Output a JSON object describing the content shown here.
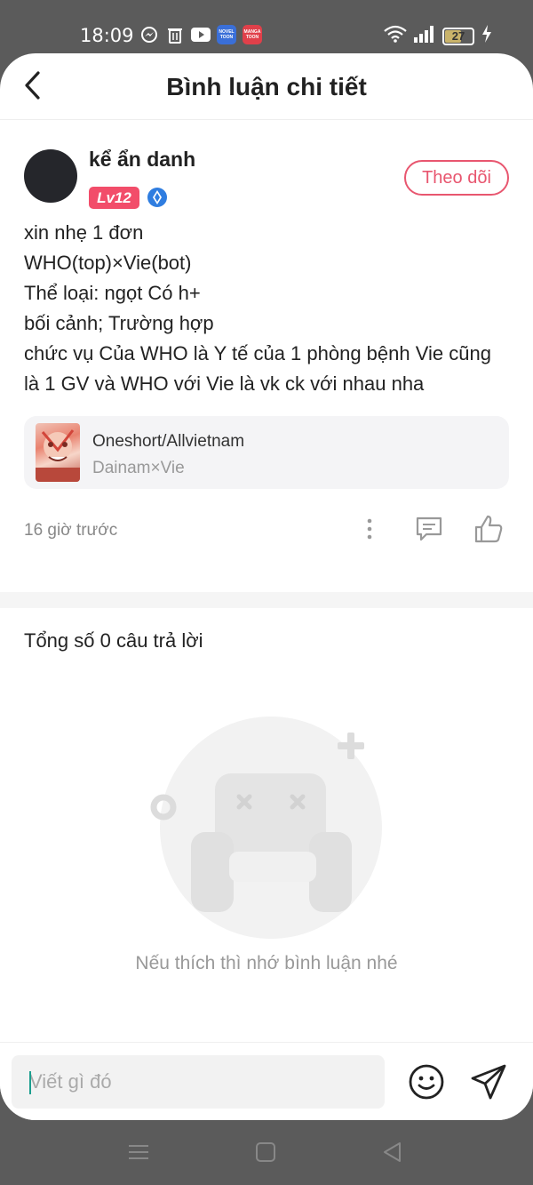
{
  "status_bar": {
    "time": "18:09",
    "battery": "27",
    "app_icons": [
      "messenger-icon",
      "trash-icon",
      "youtube-icon",
      "novel-toon-icon",
      "manga-toon-icon"
    ],
    "novel_toon_label": "NOVEL TOON",
    "manga_toon_label": "MANGA TOON"
  },
  "header": {
    "title": "Bình luận chi tiết"
  },
  "post": {
    "username": "kể ẩn danh",
    "level": "Lv12",
    "follow_label": "Theo dõi",
    "lines": [
      "xin nhẹ 1 đơn",
      "WHO(top)×Vie(bot)",
      "Thể loại: ngọt Có h+",
      "bối cảnh; Trường hợp",
      "chức vụ Của WHO là Y tế của 1 phòng bệnh Vie cũng",
      "là 1 GV và WHO với Vie là vk ck với nhau nha"
    ],
    "book": {
      "title": "Oneshort/Allvietnam",
      "subtitle": "Dainam×Vie"
    },
    "time": "16 giờ trước"
  },
  "replies": {
    "count_label": "Tổng số 0 câu trả lời",
    "empty_text": "Nếu thích thì nhớ bình luận nhé"
  },
  "input": {
    "placeholder": "Viết gì đó"
  },
  "colors": {
    "accent": "#e8566f",
    "level_badge": "#f24d6a",
    "caret": "#1a9e8e"
  }
}
